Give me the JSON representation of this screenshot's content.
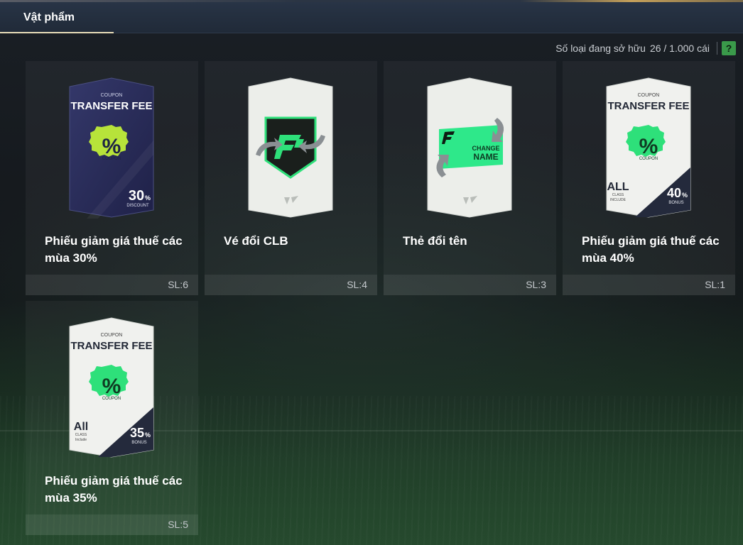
{
  "header": {
    "tab_label": "Vật phẩm"
  },
  "ownership": {
    "label": "Số loại đang sở hữu",
    "value": "26 / 1.000 cái",
    "help_label": "?"
  },
  "items": [
    {
      "name": "Phiếu giảm giá thuế các mùa 30%",
      "qty": "SL:6",
      "card": {
        "type": "coupon-dark",
        "small": "COUPON",
        "title": "TRANSFER FEE",
        "badge_symbol": "%",
        "badge_text": "COUPON",
        "value": "30",
        "value_unit": "%",
        "value_sub": "DISCOUNT"
      }
    },
    {
      "name": "Vé đổi CLB",
      "qty": "SL:4",
      "card": {
        "type": "club-swap",
        "icon": "club-swap-icon"
      }
    },
    {
      "name": "Thẻ đổi tên",
      "qty": "SL:3",
      "card": {
        "type": "change-name",
        "line1": "CHANGE",
        "line2": "NAME"
      }
    },
    {
      "name": "Phiếu giảm giá thuế các mùa 40%",
      "qty": "SL:1",
      "card": {
        "type": "coupon-light",
        "small": "COUPON",
        "title": "TRANSFER FEE",
        "badge_symbol": "%",
        "badge_text": "COUPON",
        "class_big": "ALL",
        "class_small1": "CLASS",
        "class_small2": "INCLUDE",
        "value": "40",
        "value_unit": "%",
        "value_sub": "BONUS"
      }
    },
    {
      "name": "Phiếu giảm giá thuế các mùa 35%",
      "qty": "SL:5",
      "card": {
        "type": "coupon-light",
        "small": "COUPON",
        "title": "TRANSFER FEE",
        "badge_symbol": "%",
        "badge_text": "COUPON",
        "class_big": "All",
        "class_small1": "CLASS",
        "class_small2": "Include",
        "value": "35",
        "value_unit": "%",
        "value_sub": "BONUS"
      }
    }
  ],
  "colors": {
    "accent_green": "#3fe07a",
    "header_bg": "#243042",
    "tab_underline": "#e9ddb8",
    "card_dark": "#2c2f5a"
  }
}
